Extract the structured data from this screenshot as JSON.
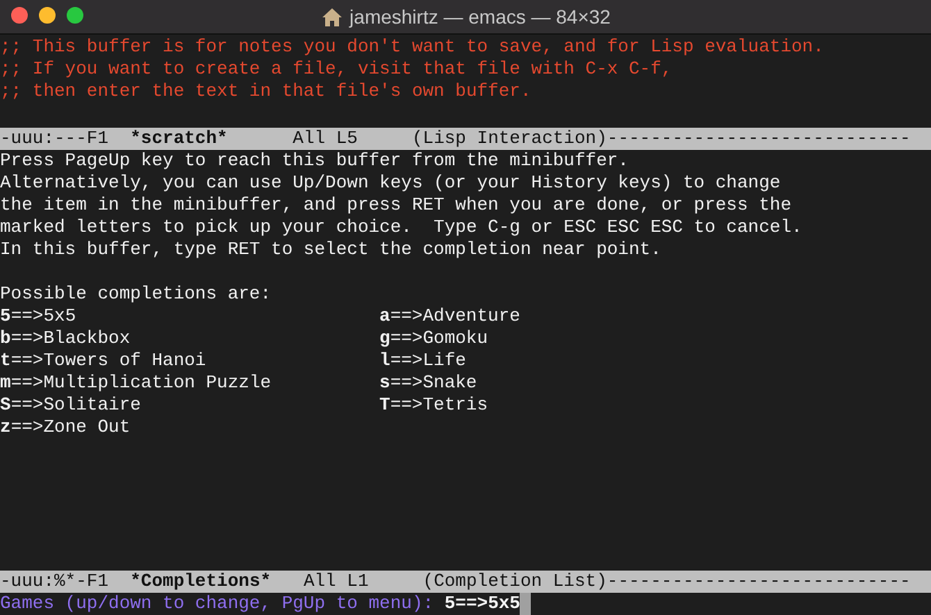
{
  "window": {
    "title": "jameshirtz — emacs — 84×32"
  },
  "comments": [
    ";; This buffer is for notes you don't want to save, and for Lisp evaluation.",
    ";; If you want to create a file, visit that file with C-x C-f,",
    ";; then enter the text in that file's own buffer."
  ],
  "scratch_mode_line": {
    "status": "-uuu:---F1  ",
    "buffer": "*scratch*",
    "position": "      All L5     ",
    "mode": "(Lisp Interaction)----------------------------"
  },
  "help_text": [
    "Press PageUp key to reach this buffer from the minibuffer.",
    "Alternatively, you can use Up/Down keys (or your History keys) to change",
    "the item in the minibuffer, and press RET when you are done, or press the",
    "marked letters to pick up your choice.  Type C-g or ESC ESC ESC to cancel.",
    "In this buffer, type RET to select the completion near point."
  ],
  "completions_heading": "Possible completions are:",
  "completions": [
    {
      "key": "5",
      "name": "==>5x5"
    },
    {
      "key": "a",
      "name": "==>Adventure"
    },
    {
      "key": "b",
      "name": "==>Blackbox"
    },
    {
      "key": "g",
      "name": "==>Gomoku"
    },
    {
      "key": "t",
      "name": "==>Towers of Hanoi"
    },
    {
      "key": "l",
      "name": "==>Life"
    },
    {
      "key": "m",
      "name": "==>Multiplication Puzzle"
    },
    {
      "key": "s",
      "name": "==>Snake"
    },
    {
      "key": "S",
      "name": "==>Solitaire"
    },
    {
      "key": "T",
      "name": "==>Tetris"
    },
    {
      "key": "z",
      "name": "==>Zone Out"
    }
  ],
  "completions_mode_line": {
    "status": "-uuu:%*-F1  ",
    "buffer": "*Completions*",
    "position": "   All L1     ",
    "mode": "(Completion List)----------------------------"
  },
  "minibuffer": {
    "prompt": "Games (up/down to change, PgUp to menu): ",
    "value": "5==>5x5"
  }
}
